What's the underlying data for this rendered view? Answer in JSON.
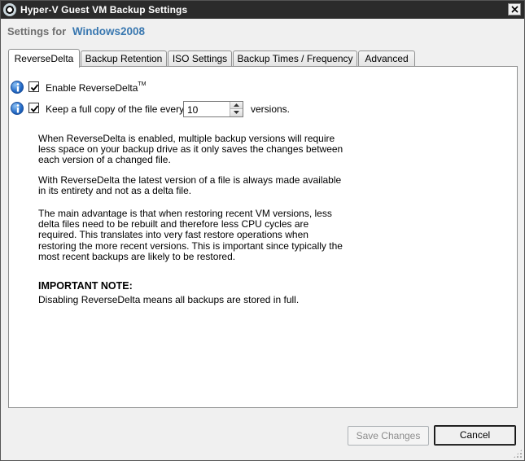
{
  "window": {
    "title": "Hyper-V Guest VM Backup Settings"
  },
  "header": {
    "settings_for": "Settings for",
    "vm_name": "Windows2008"
  },
  "tabs": [
    {
      "label": "ReverseDelta",
      "active": true
    },
    {
      "label": "Backup Retention",
      "active": false
    },
    {
      "label": "ISO Settings",
      "active": false
    },
    {
      "label": "Backup Times / Frequency",
      "active": false
    },
    {
      "label": "Advanced",
      "active": false
    }
  ],
  "reverse_delta": {
    "enable": {
      "label": "Enable ReverseDelta",
      "tm": "TM",
      "checked": true
    },
    "full_copy": {
      "label": "Keep a full copy of the file every",
      "value": "10",
      "suffix": "versions.",
      "checked": true
    },
    "paragraphs": [
      "When ReverseDelta is enabled, multiple backup versions will require less space on your backup drive as it only saves the changes between each version of a changed file.",
      "With ReverseDelta the latest version of a file is always made available in its entirety and not as a delta file.",
      "The main advantage is that when restoring recent VM versions, less delta files need to be rebuilt and therefore less CPU cycles are required.  This translates into very fast restore operations when restoring the more recent versions.  This is important since typically the most recent backups are likely to be restored."
    ],
    "note_title": "IMPORTANT NOTE:",
    "note_text": "Disabling ReverseDelta means all backups are stored in full."
  },
  "footer": {
    "save_label": "Save Changes",
    "cancel_label": "Cancel"
  },
  "colors": {
    "titlebar": "#2b2b2b",
    "vm_name": "#3a78b0",
    "info_icon": "#2168c4"
  }
}
